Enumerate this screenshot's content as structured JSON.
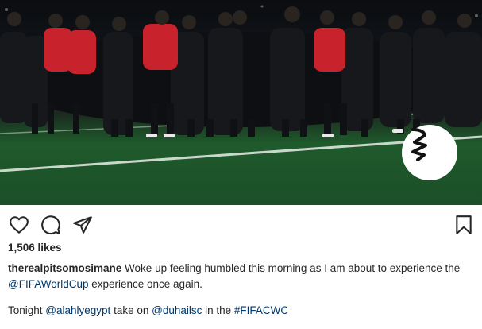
{
  "post": {
    "image_description_icon": "team-huddle-photo",
    "badge_icon": "club-logo-icon"
  },
  "actions": {
    "like_icon": "heart-icon",
    "comment_icon": "comment-icon",
    "share_icon": "share-icon",
    "save_icon": "bookmark-icon"
  },
  "likes": {
    "count_label": "1,506 likes"
  },
  "caption": {
    "username": "therealpitsomosimane",
    "text_1": " Woke up feeling humbled this morning as I am about to experience the ",
    "mention_1": "@FIFAWorldCup",
    "text_2": " experience once again."
  },
  "caption2": {
    "text_1": "Tonight ",
    "mention_1": "@alahlyegypt",
    "text_2": " take on ",
    "mention_2": "@duhailsc",
    "text_3": " in the ",
    "hashtag": "#FIFACWC"
  },
  "colors": {
    "link": "#00376b",
    "text": "#262626",
    "jersey_red": "#c8232c",
    "pitch_green": "#1f5a2c"
  }
}
